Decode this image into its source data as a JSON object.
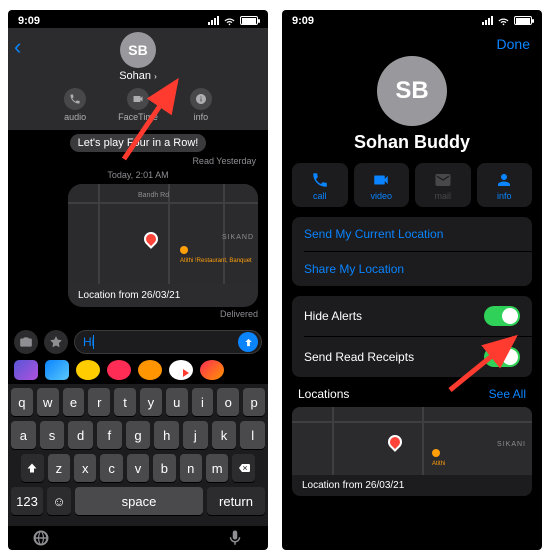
{
  "status": {
    "time": "9:09"
  },
  "left": {
    "contact_initials": "SB",
    "contact_name": "Sohan",
    "action_audio": "audio",
    "action_facetime": "FaceTime",
    "action_info": "info",
    "banner_msg": "Let's play Four in a Row!",
    "read_status": "Read Yesterday",
    "time_stamp": "Today, 2:01 AM",
    "map_road_label": "Bandh Rd",
    "map_area_label": "SIKAND",
    "map_poi": "Atithi  !Restaurant, Banquet",
    "map_caption": "Location from 26/03/21",
    "delivered": "Delivered",
    "input_text": "Hi",
    "key_123": "123",
    "key_space": "space",
    "key_return": "return",
    "keys_r1": [
      "q",
      "w",
      "e",
      "r",
      "t",
      "y",
      "u",
      "i",
      "o",
      "p"
    ],
    "keys_r2": [
      "a",
      "s",
      "d",
      "f",
      "g",
      "h",
      "j",
      "k",
      "l"
    ],
    "keys_r3": [
      "z",
      "x",
      "c",
      "v",
      "b",
      "n",
      "m"
    ]
  },
  "right": {
    "done": "Done",
    "contact_initials": "SB",
    "contact_name": "Sohan Buddy",
    "btn_call": "call",
    "btn_video": "video",
    "btn_mail": "mail",
    "btn_info": "info",
    "link_send_loc": "Send My Current Location",
    "link_share_loc": "Share My Location",
    "row_hide_alerts": "Hide Alerts",
    "row_read_receipts": "Send Read Receipts",
    "locations_header": "Locations",
    "see_all": "See All",
    "map_area_label": "SIKANI",
    "map_poi": "Atithi",
    "map_caption": "Location from 26/03/21"
  }
}
